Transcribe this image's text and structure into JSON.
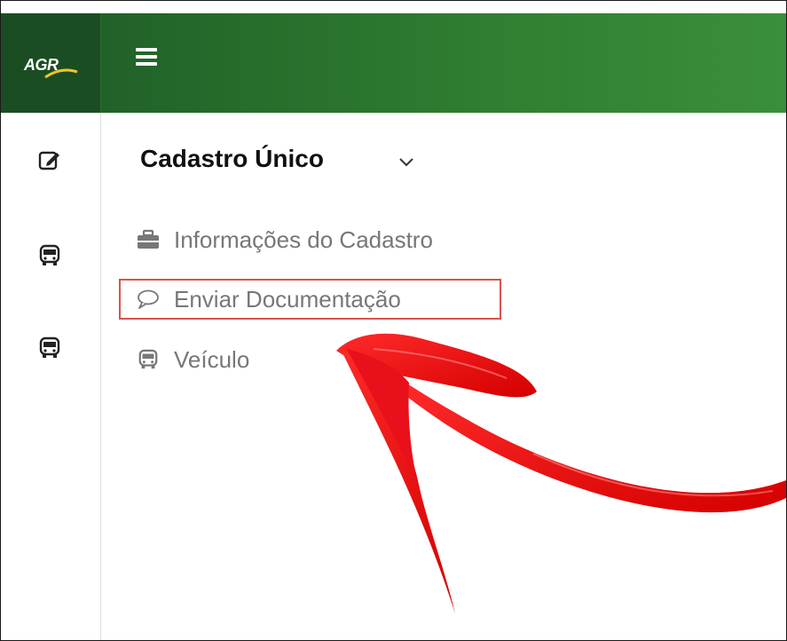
{
  "brand": {
    "logo_text": "AGR",
    "primary_color": "#2f7d31",
    "accent_color": "#d9534f"
  },
  "topbar": {
    "menu_icon": "hamburger-icon"
  },
  "sidebar": {
    "icons": [
      "edit-icon",
      "bus-icon",
      "bus-icon"
    ]
  },
  "section": {
    "title": "Cadastro Único",
    "chevron_icon": "chevron-down-icon",
    "items": [
      {
        "label": "Informações do Cadastro",
        "icon": "briefcase-icon"
      },
      {
        "label": "Enviar Documentação",
        "icon": "comment-icon",
        "highlighted": true
      },
      {
        "label": "Veículo",
        "icon": "bus-icon"
      }
    ]
  },
  "annotation": {
    "type": "red-arrow",
    "points_to": "Enviar Documentação",
    "color": "#e8101a"
  }
}
